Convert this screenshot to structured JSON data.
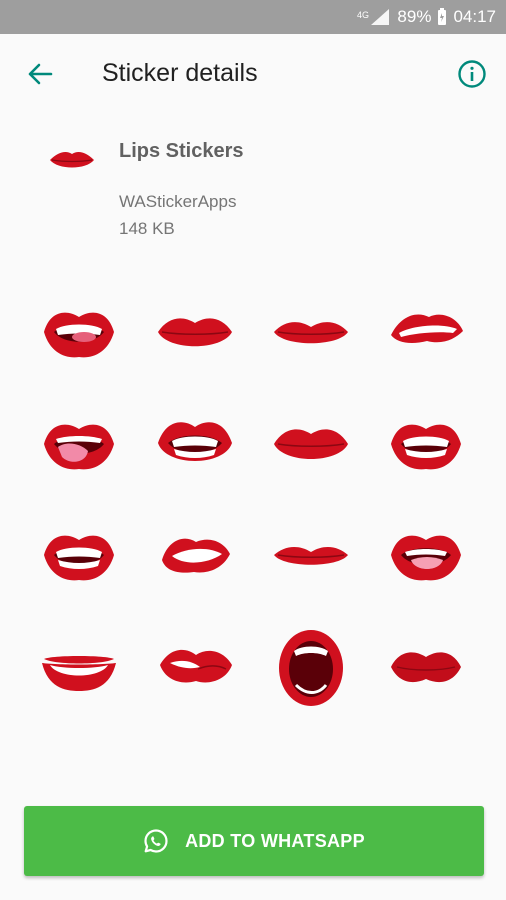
{
  "status_bar": {
    "network": "4G",
    "battery": "89%",
    "time": "04:17"
  },
  "app_bar": {
    "title": "Sticker details",
    "back_icon": "arrow-back-icon",
    "info_icon": "info-icon"
  },
  "pack": {
    "name": "Lips Stickers",
    "publisher": "WAStickerApps",
    "size": "148 KB"
  },
  "stickers": [
    {
      "variant": "open-teeth-tongue"
    },
    {
      "variant": "pout-side"
    },
    {
      "variant": "closed-wide"
    },
    {
      "variant": "bite-lip"
    },
    {
      "variant": "tongue-out"
    },
    {
      "variant": "grin-teeth"
    },
    {
      "variant": "closed-full"
    },
    {
      "variant": "open-teeth"
    },
    {
      "variant": "open-teeth"
    },
    {
      "variant": "smile-teeth-tilt"
    },
    {
      "variant": "closed-thin"
    },
    {
      "variant": "open-tongue"
    },
    {
      "variant": "smile-teeth"
    },
    {
      "variant": "bite-lip-side"
    },
    {
      "variant": "open-wide"
    },
    {
      "variant": "kiss-pout"
    }
  ],
  "actions": {
    "add_label": "ADD TO WHATSAPP"
  },
  "colors": {
    "accent": "#00897b",
    "button": "#4cbb47",
    "lip": "#d0101e"
  }
}
